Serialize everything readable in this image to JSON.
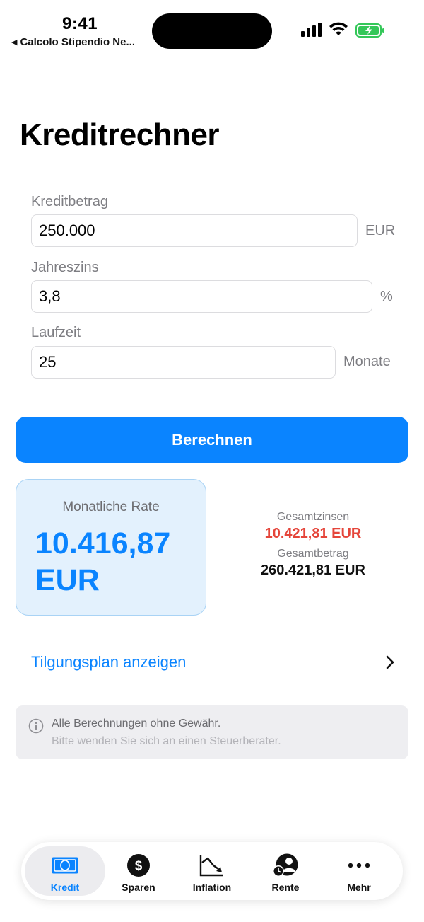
{
  "status_bar": {
    "time": "9:41",
    "back_app": "Calcolo Stipendio Ne...",
    "back_icon": "back-triangle-icon",
    "battery_color": "#34c759"
  },
  "page": {
    "title": "Kreditrechner"
  },
  "form": {
    "loan_amount": {
      "label": "Kreditbetrag",
      "value": "250.000",
      "unit": "EUR"
    },
    "interest": {
      "label": "Jahreszins",
      "value": "3,8",
      "unit": "%"
    },
    "term": {
      "label": "Laufzeit",
      "value": "25",
      "unit": "Monate"
    }
  },
  "calculate_button": {
    "label": "Berechnen",
    "color": "#0a84ff"
  },
  "result": {
    "monthly_label": "Monatliche Rate",
    "monthly_value": "10.416,87 EUR",
    "total_interest_label": "Gesamtzinsen",
    "total_interest_value": "10.421,81 EUR",
    "total_amount_label": "Gesamtbetrag",
    "total_amount_value": "260.421,81 EUR",
    "interest_color": "#e5453a"
  },
  "schedule_link": {
    "label": "Tilgungsplan anzeigen",
    "icon": "chevron-right-icon"
  },
  "disclaimer": {
    "icon": "info-icon",
    "line1": "Alle Berechnungen ohne Gewähr.",
    "line2": "Bitte wenden Sie sich an einen Steuerberater."
  },
  "tab_bar": {
    "tabs": [
      {
        "label": "Kredit",
        "icon": "banknote-icon",
        "active": true
      },
      {
        "label": "Sparen",
        "icon": "dollar-circle-icon",
        "active": false
      },
      {
        "label": "Inflation",
        "icon": "chart-down-icon",
        "active": false
      },
      {
        "label": "Rente",
        "icon": "person-clock-icon",
        "active": false
      },
      {
        "label": "Mehr",
        "icon": "ellipsis-icon",
        "active": false
      }
    ]
  }
}
